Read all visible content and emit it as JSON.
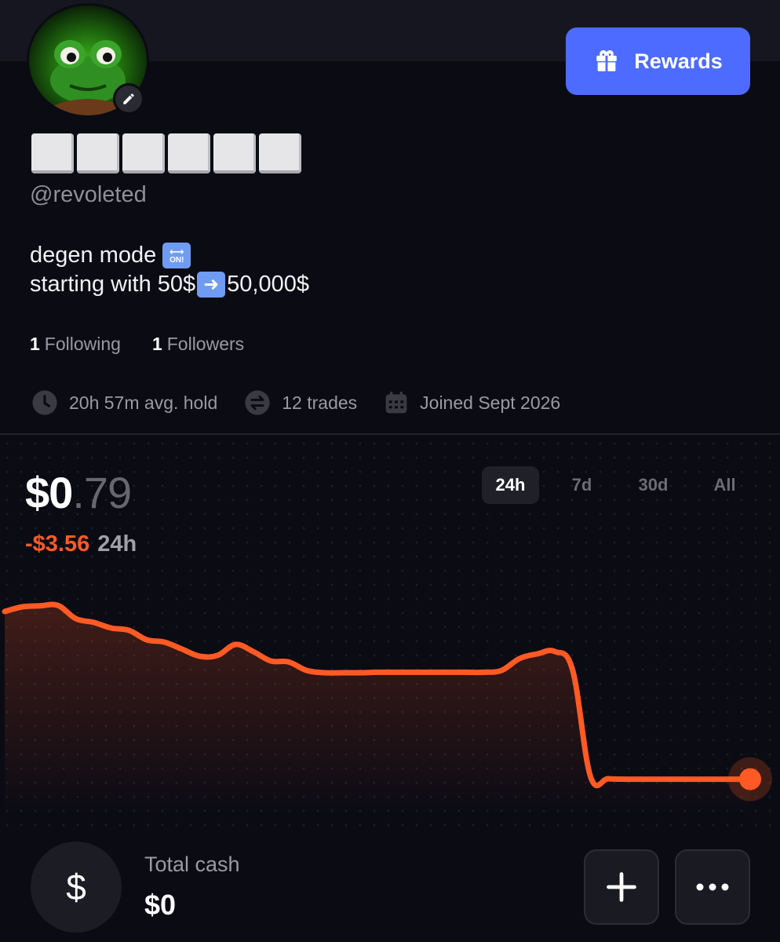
{
  "header": {
    "rewards_label": "Rewards",
    "rewards_icon": "gift-icon",
    "accent_color": "#4d6bff"
  },
  "profile": {
    "avatar": "frog-avatar",
    "display_name": "⬜⬜⬜⬜⬜⬜",
    "handle": "@revoleted",
    "bio_line1": "degen mode",
    "bio_line1_emoji": "ON!",
    "bio_line2_a": "starting with 50$",
    "bio_line2_b": "50,000$",
    "following_count": "1",
    "following_label": "Following",
    "followers_count": "1",
    "followers_label": "Followers",
    "stats": {
      "avg_hold": "20h 57m avg. hold",
      "trades": "12 trades",
      "joined": "Joined Sept 2026"
    }
  },
  "portfolio": {
    "price_main": "$0",
    "price_cents": ".79",
    "change": "-$3.56",
    "change_period": "24h",
    "ranges": [
      "24h",
      "7d",
      "30d",
      "All"
    ],
    "active_range": "24h",
    "line_color": "#ff5a24"
  },
  "chart_data": {
    "type": "line",
    "x": [
      0,
      1,
      2,
      3,
      4,
      5,
      6,
      7,
      8,
      9,
      10,
      11,
      12,
      13,
      14,
      15,
      16,
      17,
      18,
      19,
      20,
      21,
      22,
      23,
      24,
      25,
      26,
      27,
      28,
      29,
      30,
      31,
      32,
      33,
      34,
      35,
      36,
      37,
      38,
      39,
      40,
      41,
      42
    ],
    "series": [
      {
        "values": [
          4.35,
          4.45,
          4.47,
          4.48,
          4.2,
          4.12,
          4.0,
          3.95,
          3.75,
          3.7,
          3.55,
          3.4,
          3.42,
          3.65,
          3.5,
          3.3,
          3.28,
          3.1,
          3.05,
          3.05,
          3.05,
          3.06,
          3.06,
          3.06,
          3.06,
          3.06,
          3.06,
          3.06,
          3.1,
          3.35,
          3.45,
          3.5,
          3.1,
          0.85,
          0.8,
          0.79,
          0.79,
          0.79,
          0.79,
          0.79,
          0.79,
          0.79,
          0.79
        ]
      }
    ],
    "title": "",
    "xlabel": "",
    "ylabel": "",
    "ylim": [
      0,
      5
    ],
    "grid": "dots"
  },
  "cash": {
    "label": "Total cash",
    "value": "$0",
    "icon_symbol": "$"
  },
  "actions": {
    "add_icon": "plus-icon",
    "more_icon": "more-icon"
  }
}
